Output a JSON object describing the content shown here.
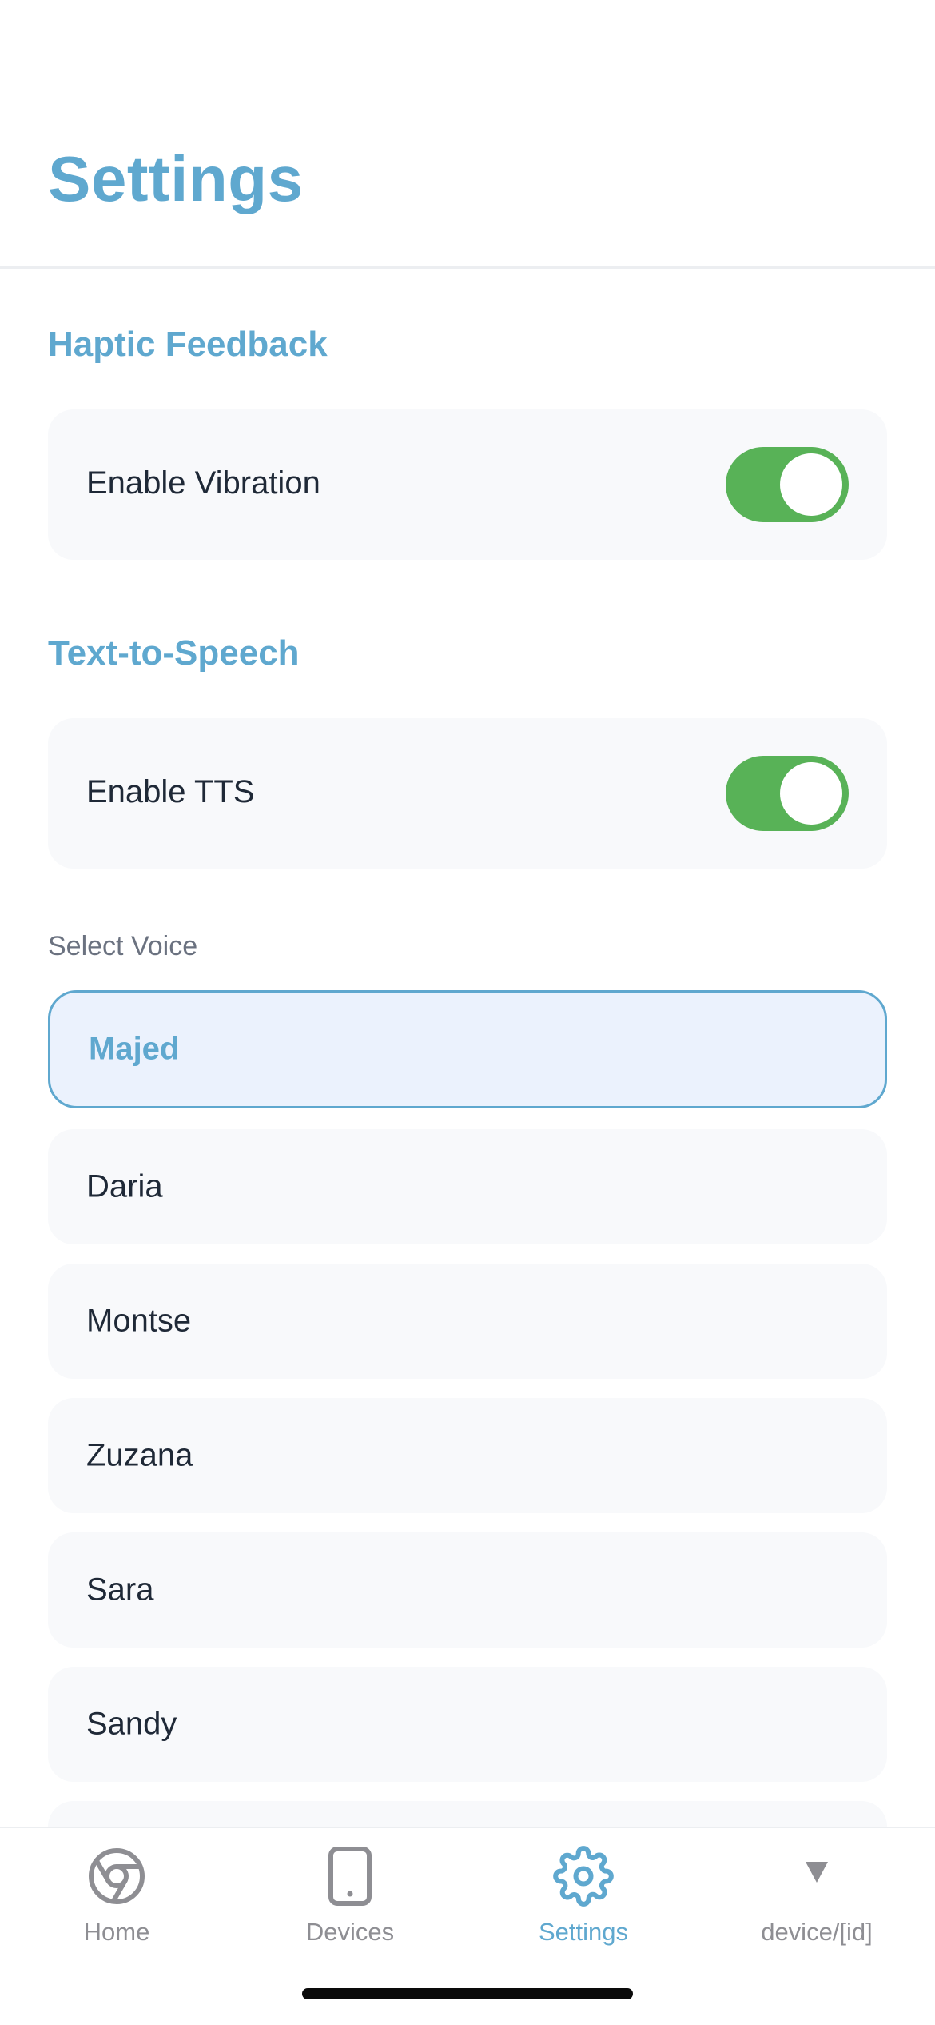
{
  "header": {
    "title": "Settings"
  },
  "haptic": {
    "section_title": "Haptic Feedback",
    "row_label": "Enable Vibration",
    "enabled": true
  },
  "tts": {
    "section_title": "Text-to-Speech",
    "row_label": "Enable TTS",
    "enabled": true,
    "voice_label": "Select Voice",
    "voices": [
      {
        "name": "Majed",
        "selected": true
      },
      {
        "name": "Daria",
        "selected": false
      },
      {
        "name": "Montse",
        "selected": false
      },
      {
        "name": "Zuzana",
        "selected": false
      },
      {
        "name": "Sara",
        "selected": false
      },
      {
        "name": "Sandy",
        "selected": false
      }
    ]
  },
  "tabbar": {
    "tabs": [
      {
        "label": "Home",
        "icon": "chrome-icon",
        "active": false
      },
      {
        "label": "Devices",
        "icon": "smartphone-icon",
        "active": false
      },
      {
        "label": "Settings",
        "icon": "gear-icon",
        "active": true
      },
      {
        "label": "device/[id]",
        "icon": "triangle-down-icon",
        "active": false
      }
    ]
  },
  "colors": {
    "accent": "#5fa8cf",
    "toggle_on": "#58b257",
    "card_bg": "#f8f9fb",
    "selected_bg": "#ebf2fd",
    "inactive_tab": "#8e8e93"
  }
}
